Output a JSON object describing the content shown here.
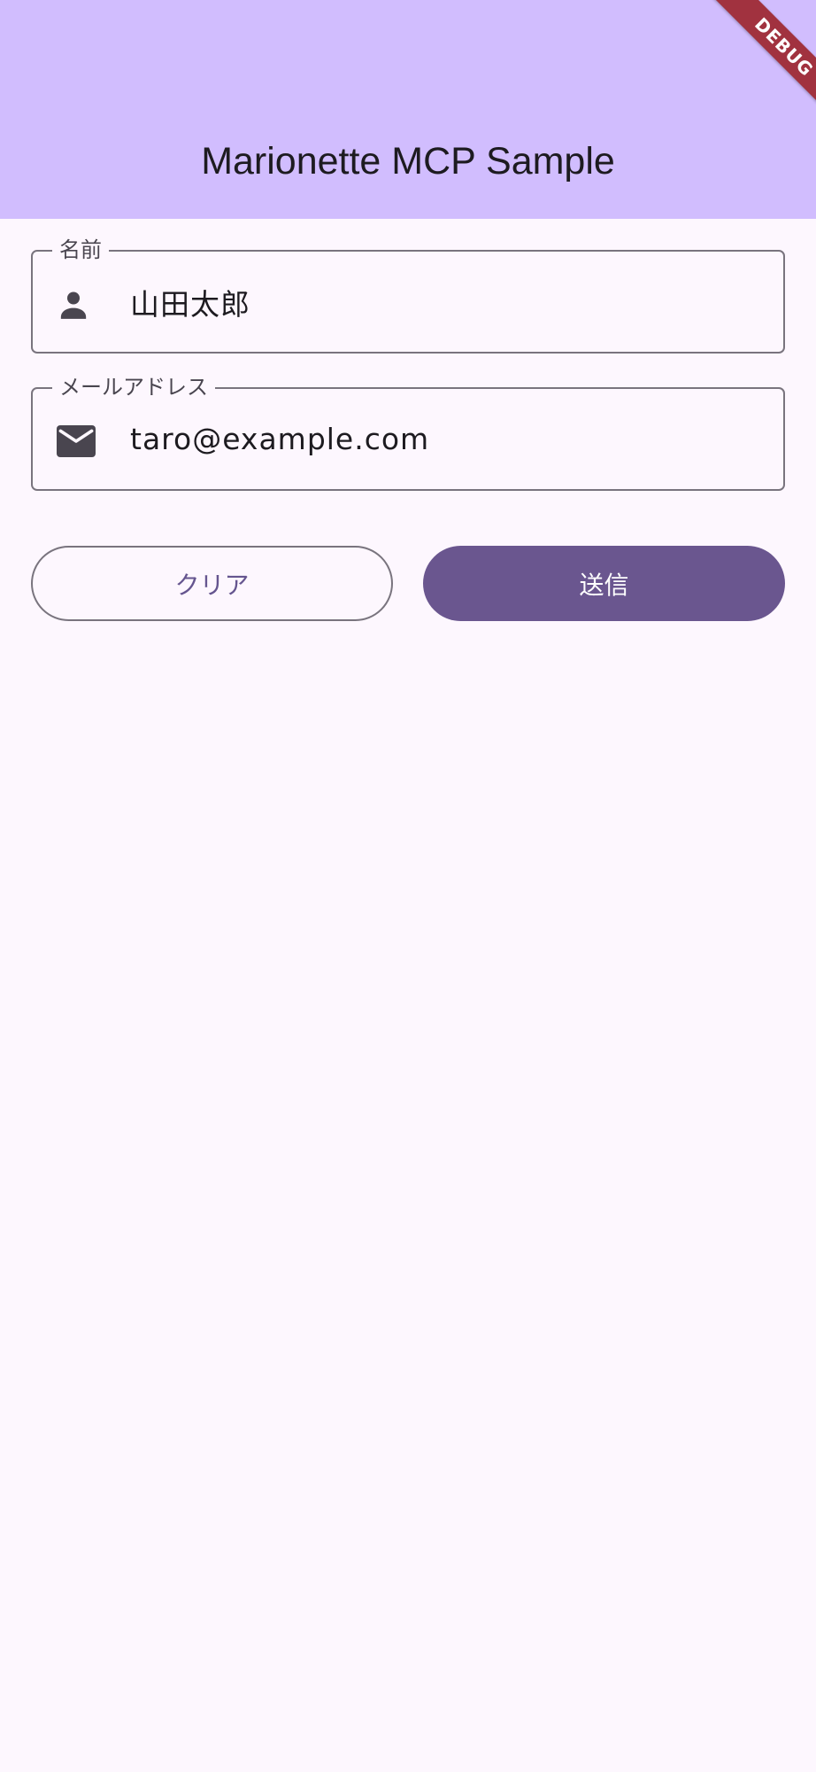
{
  "app_bar": {
    "title": "Marionette MCP Sample"
  },
  "debug_banner": {
    "label": "DEBUG"
  },
  "form": {
    "name_field": {
      "label": "名前",
      "value": "山田太郎",
      "icon": "person-icon"
    },
    "email_field": {
      "label": "メールアドレス",
      "value": "taro@example.com",
      "icon": "mail-icon"
    }
  },
  "buttons": {
    "clear_label": "クリア",
    "submit_label": "送信"
  },
  "colors": {
    "app_bar_bg": "#D1BDFE",
    "page_bg": "#FDF7FE",
    "primary": "#6A568F",
    "outline": "#79747E",
    "debug_ribbon": "#A1323F"
  }
}
